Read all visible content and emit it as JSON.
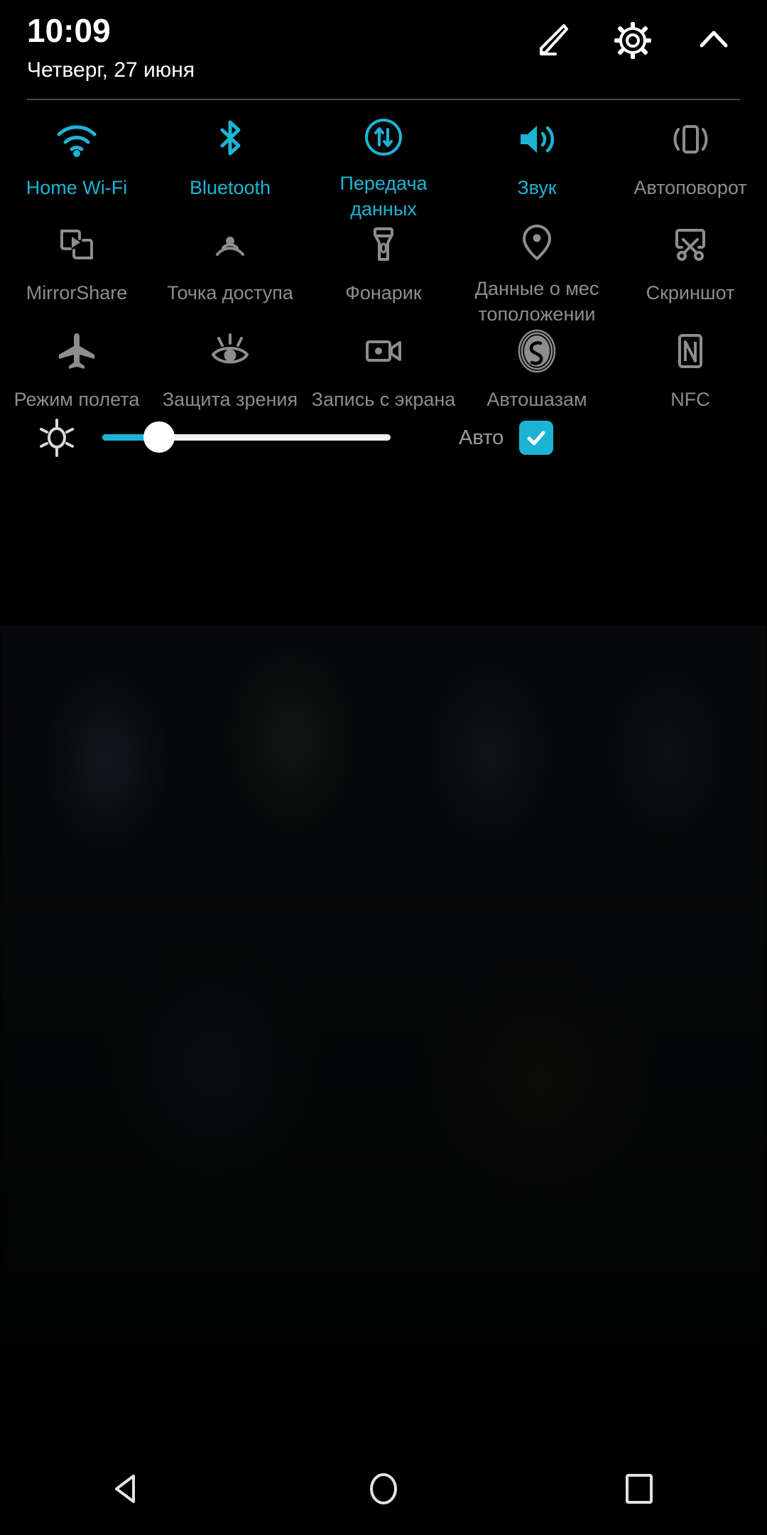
{
  "status": {
    "time": "10:09",
    "date": "Четверг, 27 июня"
  },
  "header": {
    "edit_icon": "pencil-edit-icon",
    "settings_icon": "gear-icon",
    "collapse_icon": "chevron-up-icon"
  },
  "colors": {
    "accent": "#1cb4d4",
    "inactive": "#8d8d8d",
    "background": "#000000"
  },
  "tiles": {
    "rows": [
      [
        {
          "label": "Home Wi-Fi",
          "icon": "wifi-icon",
          "active": true
        },
        {
          "label": "Bluetooth",
          "icon": "bluetooth-icon",
          "active": true
        },
        {
          "label": "Передача данных",
          "icon": "mobile-data-icon",
          "active": true
        },
        {
          "label": "Звук",
          "icon": "sound-speaker-icon",
          "active": true
        },
        {
          "label": "Автоповорот",
          "icon": "auto-rotate-icon",
          "active": false
        }
      ],
      [
        {
          "label": "MirrorShare",
          "icon": "mirrorshare-icon",
          "active": false
        },
        {
          "label": "Точка доступа",
          "icon": "hotspot-icon",
          "active": false
        },
        {
          "label": "Фонарик",
          "icon": "flashlight-icon",
          "active": false
        },
        {
          "label": "Данные о мес тоположении",
          "icon": "location-pin-icon",
          "active": false
        },
        {
          "label": "Скриншот",
          "icon": "screenshot-scissors-icon",
          "active": false
        }
      ],
      [
        {
          "label": "Режим полета",
          "icon": "airplane-icon",
          "active": false
        },
        {
          "label": "Защита зрения",
          "icon": "eye-protection-icon",
          "active": false
        },
        {
          "label": "Запись с экрана",
          "icon": "screen-record-icon",
          "active": false
        },
        {
          "label": "Автошазам",
          "icon": "shazam-icon",
          "active": false
        },
        {
          "label": "NFC",
          "icon": "nfc-icon",
          "active": false
        }
      ]
    ]
  },
  "brightness": {
    "icon": "brightness-sun-icon",
    "value_percent": 20,
    "auto_label": "Авто",
    "auto_checked": true,
    "check_icon": "checkmark-icon"
  },
  "navbar": {
    "back": "back-triangle-icon",
    "home": "home-circle-icon",
    "recents": "recents-square-icon"
  }
}
